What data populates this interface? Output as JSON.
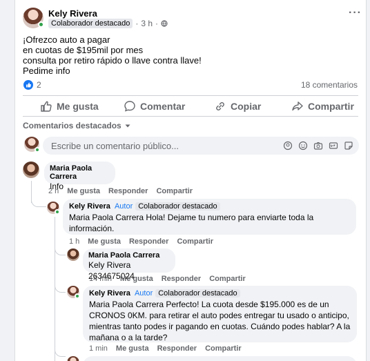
{
  "post": {
    "author": "Kely Rivera",
    "badge": "Colaborador destacado",
    "time": "3 h",
    "lines": [
      "¡Ofrezco auto a pagar",
      "en cuotas de $195mil por mes",
      "consulta por retiro rápido o llave contra llave!",
      "Pedime info"
    ],
    "reaction_count": "2",
    "comments_count": "18 comentarios",
    "more_icon": "ellipsis-icon"
  },
  "actions": {
    "like": "Me gusta",
    "comment": "Comentar",
    "copy": "Copiar",
    "share": "Compartir"
  },
  "filter_label": "Comentarios destacados",
  "composer": {
    "placeholder": "Escribe un comentario público..."
  },
  "comments": [
    {
      "name": "Maria Paola Carrera",
      "text": "Info",
      "time": "2 h",
      "like": "Me gusta",
      "reply": "Responder",
      "share": "Compartir"
    },
    {
      "name": "Kely Rivera",
      "author_tag": "Autor",
      "badge": "Colaborador destacado",
      "text": "Maria Paola Carrera Hola! Dejame tu numero para enviarte toda la información.",
      "time": "1 h",
      "like": "Me gusta",
      "reply": "Responder",
      "share": "Compartir"
    },
    {
      "name": "Maria Paola Carrera",
      "text": "Kely Rivera 2634675024",
      "time": "14 min",
      "like": "Me gusta",
      "reply": "Responder",
      "share": "Compartir"
    },
    {
      "name": "Kely Rivera",
      "author_tag": "Autor",
      "badge": "Colaborador destacado",
      "text": "Maria Paola Carrera Perfecto! La cuota desde $195.000 es de un CRONOS 0KM. para retirar el auto podes entregar tu usado o anticipo, mientras tanto podes ir pagando en cuotas. Cuándo podes hablar? A la mañana o a la tarde?",
      "time": "1 min",
      "like": "Me gusta",
      "reply": "Responder",
      "share": "Compartir"
    }
  ],
  "colors": {
    "accent": "#1877f2",
    "online": "#31a24c",
    "bubble": "#f0f2f5"
  }
}
